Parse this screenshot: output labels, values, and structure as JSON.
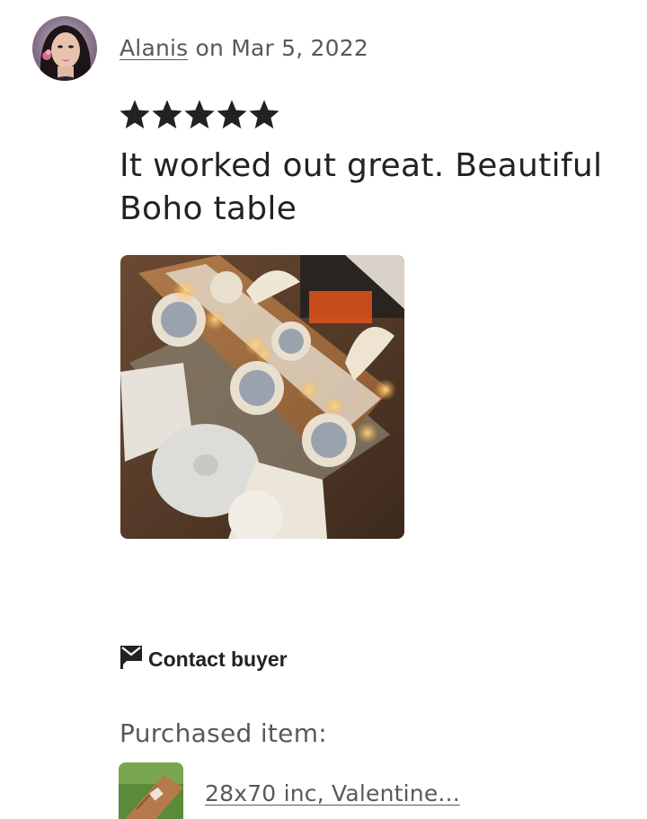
{
  "review": {
    "reviewer_name": "Alanis",
    "date_text": " on Mar 5, 2022",
    "rating": 5,
    "rating_max": 5,
    "text": "It worked out great. Beautiful Boho table",
    "star_color": "#222222"
  },
  "actions": {
    "contact_label": "Contact buyer"
  },
  "purchased": {
    "label": "Purchased item:",
    "item_title": "28x70 inc, Valentine..."
  },
  "icons": {
    "contact": "envelope-flag-icon",
    "star": "star-icon"
  }
}
